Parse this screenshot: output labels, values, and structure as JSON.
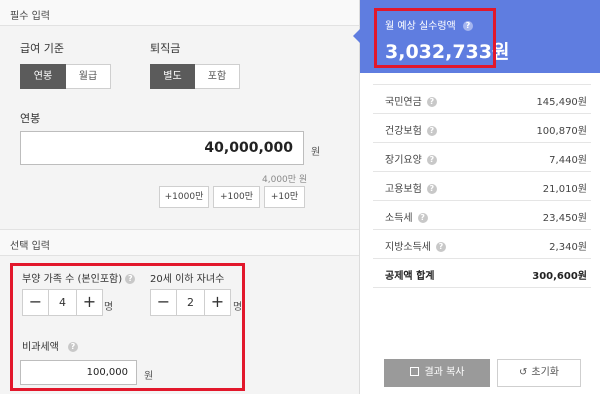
{
  "required": {
    "section_title": "필수 입력",
    "salary_basis": {
      "label": "급여 기준",
      "options": [
        "연봉",
        "월급"
      ],
      "selected": "연봉"
    },
    "severance": {
      "label": "퇴직금",
      "options": [
        "별도",
        "포함"
      ],
      "selected": "별도"
    },
    "salary": {
      "label": "연봉",
      "value": "40,000,000",
      "unit": "원",
      "hint": "4,000만 원"
    },
    "quick_add": [
      "+1000만",
      "+100만",
      "+10만"
    ]
  },
  "optional": {
    "section_title": "선택 입력",
    "dependents": {
      "label": "부양 가족 수 (본인포함)",
      "value": "4",
      "unit": "명"
    },
    "children": {
      "label": "20세 이하 자녀수",
      "value": "2",
      "unit": "명"
    },
    "nontaxable": {
      "label": "비과세액",
      "value": "100,000",
      "unit": "원"
    }
  },
  "result": {
    "title": "월 예상 실수령액",
    "amount": "3,032,733원",
    "items": [
      {
        "name": "국민연금",
        "amount": "145,490원"
      },
      {
        "name": "건강보험",
        "amount": "100,870원"
      },
      {
        "name": "장기요양",
        "amount": "7,440원"
      },
      {
        "name": "고용보험",
        "amount": "21,010원"
      },
      {
        "name": "소득세",
        "amount": "23,450원"
      },
      {
        "name": "지방소득세",
        "amount": "2,340원"
      }
    ],
    "total": {
      "name": "공제액 합계",
      "amount": "300,600원"
    },
    "copy_button": "결과 복사",
    "reset_button": "초기화"
  },
  "colors": {
    "accent": "#5f7de0",
    "highlight": "#e2172b",
    "selected_toggle": "#5b5b5b"
  }
}
